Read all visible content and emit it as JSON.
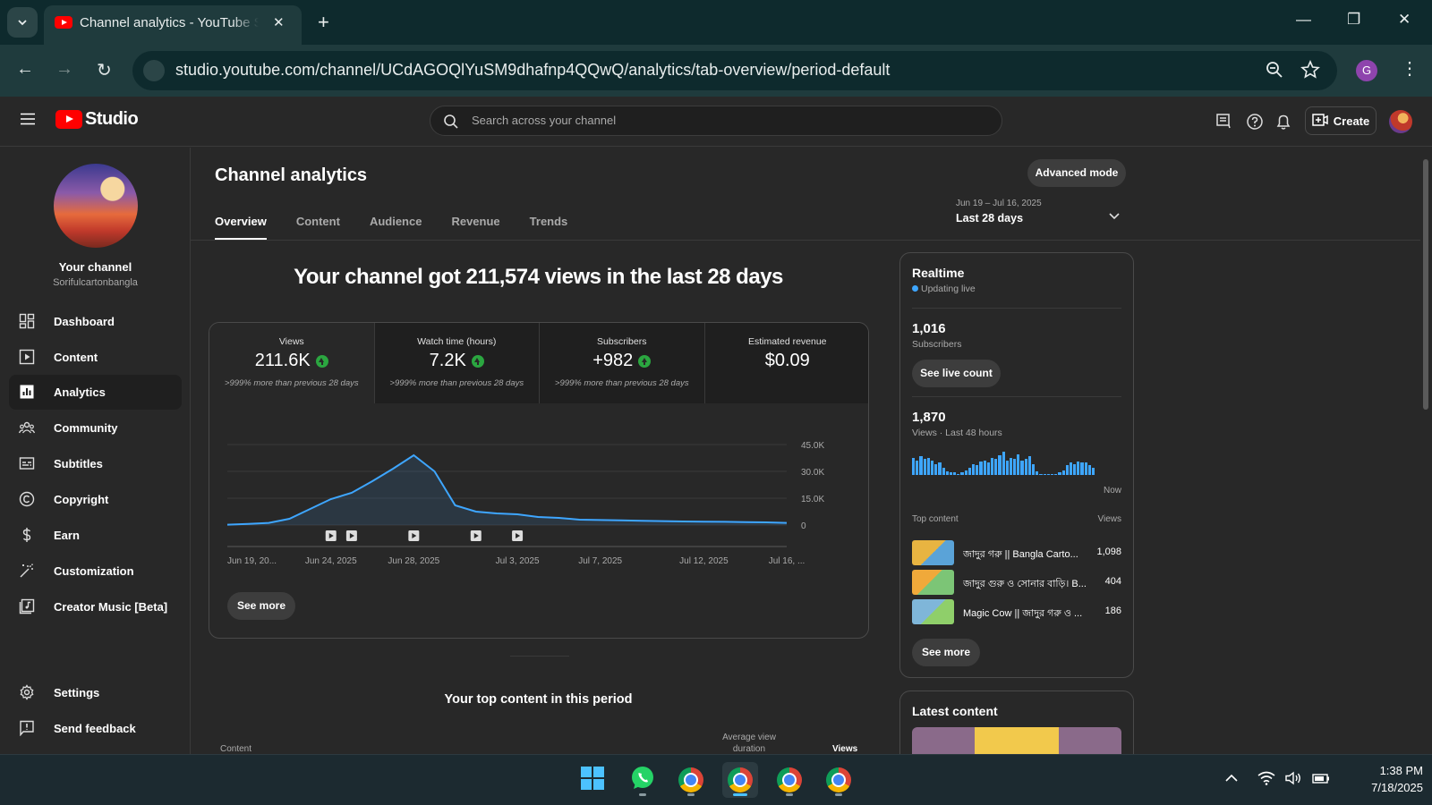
{
  "browser": {
    "tab_title": "Channel analytics - YouTube Studio",
    "url": "studio.youtube.com/channel/UCdAGOQlYuSM9dhafnp4QQwQ/analytics/tab-overview/period-default",
    "profile_initial": "G"
  },
  "header": {
    "logo_text": "Studio",
    "search_placeholder": "Search across your channel",
    "create_label": "Create"
  },
  "sidebar": {
    "channel_title": "Your channel",
    "channel_handle": "Sorifulcartonbangla",
    "items": [
      {
        "label": "Dashboard",
        "icon": "dashboard-icon"
      },
      {
        "label": "Content",
        "icon": "content-icon"
      },
      {
        "label": "Analytics",
        "icon": "analytics-icon",
        "active": true
      },
      {
        "label": "Community",
        "icon": "community-icon"
      },
      {
        "label": "Subtitles",
        "icon": "subtitles-icon"
      },
      {
        "label": "Copyright",
        "icon": "copyright-icon"
      },
      {
        "label": "Earn",
        "icon": "earn-icon"
      },
      {
        "label": "Customization",
        "icon": "customization-icon"
      },
      {
        "label": "Creator Music [Beta]",
        "icon": "creator-music-icon"
      }
    ],
    "settings_label": "Settings",
    "feedback_label": "Send feedback"
  },
  "main": {
    "title": "Channel analytics",
    "advanced_mode_label": "Advanced mode",
    "tabs": [
      "Overview",
      "Content",
      "Audience",
      "Revenue",
      "Trends"
    ],
    "active_tab": "Overview",
    "date_range": {
      "dates": "Jun 19 – Jul 16, 2025",
      "label": "Last 28 days"
    },
    "headline": "Your channel got 211,574 views in the last 28 days",
    "metrics": [
      {
        "label": "Views",
        "value": "211.6K",
        "comparison": ">999% more than previous 28 days",
        "trend": "up"
      },
      {
        "label": "Watch time (hours)",
        "value": "7.2K",
        "comparison": ">999% more than previous 28 days",
        "trend": "up"
      },
      {
        "label": "Subscribers",
        "value": "+982",
        "comparison": ">999% more than previous 28 days",
        "trend": "up"
      },
      {
        "label": "Estimated revenue",
        "value": "$0.09",
        "comparison": "",
        "trend": "none"
      }
    ],
    "see_more_label": "See more",
    "top_content_title": "Your top content in this period",
    "top_content_headers": {
      "content": "Content",
      "avg_view_duration": "Average view duration",
      "views": "Views"
    }
  },
  "chart_data": {
    "type": "line",
    "title": "",
    "xlabel": "",
    "ylabel": "",
    "x": [
      "2025-06-19",
      "2025-06-20",
      "2025-06-21",
      "2025-06-22",
      "2025-06-23",
      "2025-06-24",
      "2025-06-25",
      "2025-06-26",
      "2025-06-27",
      "2025-06-28",
      "2025-06-29",
      "2025-06-30",
      "2025-07-01",
      "2025-07-02",
      "2025-07-03",
      "2025-07-04",
      "2025-07-05",
      "2025-07-06",
      "2025-07-07",
      "2025-07-08",
      "2025-07-09",
      "2025-07-10",
      "2025-07-11",
      "2025-07-12",
      "2025-07-13",
      "2025-07-14",
      "2025-07-15",
      "2025-07-16"
    ],
    "series": [
      {
        "values": [
          200,
          600,
          1200,
          3500,
          9000,
          14500,
          18000,
          24500,
          31500,
          39000,
          30000,
          11000,
          7500,
          6500,
          6000,
          4500,
          4000,
          3000,
          2800,
          2600,
          2400,
          2200,
          2000,
          1900,
          1800,
          1600,
          1500,
          1200
        ]
      }
    ],
    "x_tick_labels": [
      "Jun 19, 20...",
      "Jun 24, 2025",
      "Jun 28, 2025",
      "Jul 3, 2025",
      "Jul 7, 2025",
      "Jul 12, 2025",
      "Jul 16, ..."
    ],
    "y_tick_labels": [
      "45.0K",
      "30.0K",
      "15.0K",
      "0"
    ],
    "ylim": [
      0,
      45000
    ],
    "grid": true,
    "video_published_markers": [
      "2025-06-24",
      "2025-06-25",
      "2025-06-28",
      "2025-07-01",
      "2025-07-03"
    ]
  },
  "realtime": {
    "title": "Realtime",
    "status": "Updating live",
    "subscribers_value": "1,016",
    "subscribers_label": "Subscribers",
    "see_live_count_label": "See live count",
    "views_value": "1,870",
    "views_label": "Views · Last 48 hours",
    "bars": [
      14,
      12,
      15,
      13,
      14,
      12,
      9,
      10,
      6,
      3,
      2,
      2,
      1,
      2,
      4,
      6,
      9,
      8,
      11,
      12,
      10,
      14,
      13,
      16,
      19,
      12,
      14,
      13,
      17,
      12,
      13,
      15,
      9,
      3,
      1,
      1,
      1,
      1,
      1,
      2,
      4,
      8,
      10,
      9,
      11,
      10,
      10,
      8,
      6
    ],
    "now_label": "Now",
    "top_content_label": "Top content",
    "views_col_label": "Views",
    "top_content": [
      {
        "title": "জাদুর গরু || Bangla Carto...",
        "views": "1,098",
        "thumb_color": "#e8b441"
      },
      {
        "title": "জাদুর গুরু ও সোনার বাড়ি। B...",
        "views": "404",
        "thumb_color": "#f0a93a"
      },
      {
        "title": "Magic Cow || জাদুর গরু ও ...",
        "views": "186",
        "thumb_color": "#7fb6d9"
      }
    ],
    "see_more_label": "See more"
  },
  "latest": {
    "title": "Latest content"
  },
  "taskbar": {
    "time": "1:38 PM",
    "date": "7/18/2025",
    "apps": [
      "start-icon",
      "whatsapp-icon",
      "chrome-icon",
      "chrome-icon",
      "chrome-icon",
      "chrome-icon"
    ]
  }
}
